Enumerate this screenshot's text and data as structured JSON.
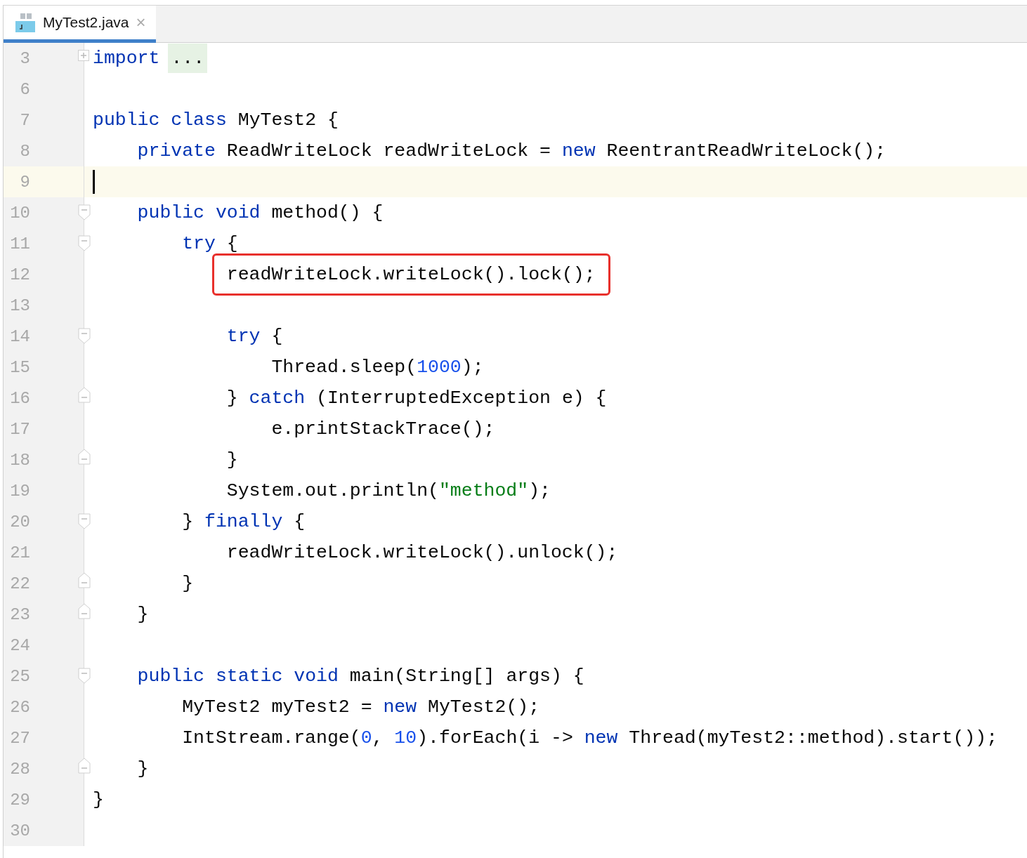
{
  "tabs": [
    {
      "label": "MyTest2.java",
      "close": "×",
      "selected": true
    }
  ],
  "lines": [
    {
      "number": "3",
      "kind": "folded",
      "tokens": [
        {
          "text": "import",
          "kind": "keyword"
        },
        {
          "text": "...",
          "kind": "folded"
        }
      ]
    },
    {
      "number": "6",
      "kind": "plain"
    },
    {
      "number": "7",
      "kind": "plain",
      "tokens": [
        {
          "text": "public class",
          "kind": "keyword"
        },
        {
          "text": " MyTest2 {",
          "kind": "plain"
        }
      ],
      "children": [
        {
          "number": "8",
          "kind": "plain",
          "tokens": [
            {
              "text": "private",
              "kind": "keyword"
            },
            {
              "text": " ReadWriteLock readWriteLock = ",
              "kind": "plain"
            },
            {
              "text": "new",
              "kind": "keyword"
            },
            {
              "text": " ReentrantReadWriteLock();",
              "kind": "plain"
            }
          ]
        },
        {
          "number": "9",
          "kind": "plain",
          "current": true
        },
        {
          "number": "10",
          "kind": "fold-start",
          "tokens": [
            {
              "text": "public void",
              "kind": "keyword"
            },
            {
              "text": " method() {",
              "kind": "plain"
            }
          ],
          "children": [
            {
              "number": "11",
              "kind": "fold-start",
              "tokens": [
                {
                  "text": "try",
                  "kind": "keyword"
                },
                {
                  "text": " {",
                  "kind": "plain"
                }
              ],
              "children": [
                {
                  "number": "12",
                  "kind": "plain",
                  "boxed": true,
                  "tokens": [
                    {
                      "text": "readWriteLock.writeLock().lock();",
                      "kind": "plain"
                    }
                  ]
                },
                {
                  "number": "13",
                  "kind": "plain"
                },
                {
                  "number": "14",
                  "kind": "fold-start",
                  "tokens": [
                    {
                      "text": "try",
                      "kind": "keyword"
                    },
                    {
                      "text": " {",
                      "kind": "plain"
                    }
                  ],
                  "children": [
                    {
                      "number": "15",
                      "kind": "plain",
                      "tokens": [
                        {
                          "text": "Thread.sleep(",
                          "kind": "plain"
                        },
                        {
                          "text": "1000",
                          "kind": "number"
                        },
                        {
                          "text": ");",
                          "kind": "plain"
                        }
                      ]
                    }
                  ]
                },
                {
                  "number": "16",
                  "kind": "fold-end",
                  "tokens": [
                    {
                      "text": "} ",
                      "kind": "plain"
                    },
                    {
                      "text": "catch",
                      "kind": "keyword"
                    },
                    {
                      "text": " (InterruptedException e) {",
                      "kind": "plain"
                    }
                  ],
                  "children": [
                    {
                      "number": "17",
                      "kind": "plain",
                      "tokens": [
                        {
                          "text": "e.printStackTrace();",
                          "kind": "plain"
                        }
                      ]
                    }
                  ]
                },
                {
                  "number": "18",
                  "kind": "fold-end",
                  "tokens": [
                    {
                      "text": "}",
                      "kind": "plain"
                    }
                  ]
                },
                {
                  "number": "19",
                  "kind": "plain",
                  "tokens": [
                    {
                      "text": "System.out.println(",
                      "kind": "plain"
                    },
                    {
                      "text": "\"method\"",
                      "kind": "string"
                    },
                    {
                      "text": ");",
                      "kind": "plain"
                    }
                  ]
                }
              ]
            },
            {
              "number": "20",
              "kind": "fold-start",
              "tokens": [
                {
                  "text": "} ",
                  "kind": "plain"
                },
                {
                  "text": "finally",
                  "kind": "keyword"
                },
                {
                  "text": " {",
                  "kind": "plain"
                }
              ],
              "children": [
                {
                  "number": "21",
                  "kind": "plain",
                  "tokens": [
                    {
                      "text": "readWriteLock.writeLock().unlock();",
                      "kind": "plain"
                    }
                  ]
                }
              ]
            },
            {
              "number": "22",
              "kind": "fold-end",
              "tokens": [
                {
                  "text": "}",
                  "kind": "plain"
                }
              ]
            }
          ]
        },
        {
          "number": "23",
          "kind": "fold-end",
          "tokens": [
            {
              "text": "}",
              "kind": "plain"
            }
          ]
        },
        {
          "number": "24",
          "kind": "plain"
        },
        {
          "number": "25",
          "kind": "fold-start",
          "tokens": [
            {
              "text": "public static void",
              "kind": "keyword"
            },
            {
              "text": " main(String[] args) {",
              "kind": "plain"
            }
          ],
          "children": [
            {
              "number": "26",
              "kind": "plain",
              "tokens": [
                {
                  "text": "MyTest2 myTest2 = ",
                  "kind": "plain"
                },
                {
                  "text": "new",
                  "kind": "keyword"
                },
                {
                  "text": " MyTest2();",
                  "kind": "plain"
                }
              ]
            },
            {
              "number": "27",
              "kind": "plain",
              "tokens": [
                {
                  "text": "IntStream.range(",
                  "kind": "plain"
                },
                {
                  "text": "0",
                  "kind": "number"
                },
                {
                  "text": ", ",
                  "kind": "plain"
                },
                {
                  "text": "10",
                  "kind": "number"
                },
                {
                  "text": ").forEach(i -> ",
                  "kind": "plain"
                },
                {
                  "text": "new",
                  "kind": "keyword"
                },
                {
                  "text": " Thread(myTest2::method).start());",
                  "kind": "plain"
                }
              ]
            }
          ]
        },
        {
          "number": "28",
          "kind": "fold-end",
          "tokens": [
            {
              "text": "}",
              "kind": "plain"
            }
          ]
        }
      ]
    },
    {
      "number": "29",
      "kind": "plain",
      "tokens": [
        {
          "text": "}",
          "kind": "plain"
        }
      ]
    },
    {
      "number": "30",
      "kind": "plain"
    }
  ]
}
